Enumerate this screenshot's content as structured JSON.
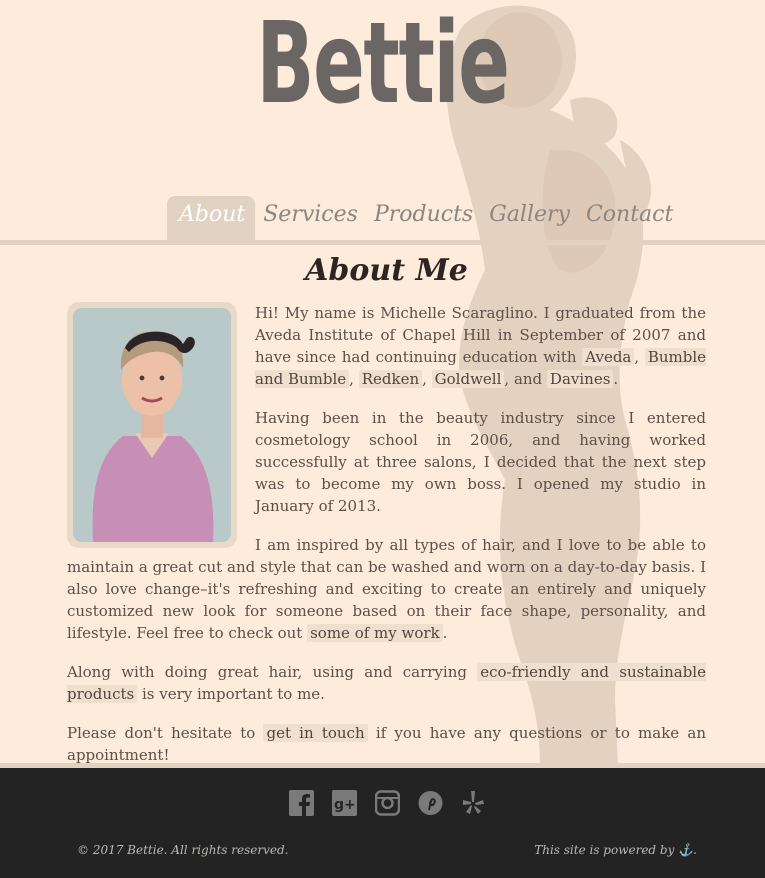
{
  "site": {
    "logo": "Bettie"
  },
  "nav": {
    "items": [
      {
        "label": "About",
        "active": true
      },
      {
        "label": "Services",
        "active": false
      },
      {
        "label": "Products",
        "active": false
      },
      {
        "label": "Gallery",
        "active": false
      },
      {
        "label": "Contact",
        "active": false
      }
    ]
  },
  "main": {
    "title": "About Me",
    "p1": {
      "t1": "Hi! My name is Michelle Scaraglino. I graduated from the Aveda Institute of Chapel Hill in September of 2007 and have since had continuing education with ",
      "l1": "Aveda",
      "t2": ", ",
      "l2": "Bumble and Bumble",
      "t3": ", ",
      "l3": "Redken",
      "t4": ", ",
      "l4": "Goldwell",
      "t5": ", and ",
      "l5": "Davines",
      "t6": "."
    },
    "p2": "Having been in the beauty industry since I entered cosmetology school in 2006, and having worked successfully at three salons, I decided that the next step was to become my own boss. I opened my studio in January of 2013.",
    "p3": {
      "t1": "I am inspired by all types of hair, and I love to be able to maintain a great cut and style that can be washed and worn on a day-to-day basis. I also love change–it's refreshing and exciting to create an entirely and uniquely customized new look for someone based on their face shape, personality, and lifestyle. Feel free to check out ",
      "l1": "some of my work",
      "t2": "."
    },
    "p4": {
      "t1": "Along with doing great hair, using and carrying ",
      "l1": "eco-friendly and sustainable products",
      "t2": " is very important to me."
    },
    "p5": {
      "t1": "Please don't hesitate to ",
      "l1": "get in touch",
      "t2": " if you have any questions or to make an appointment!"
    }
  },
  "footer": {
    "social": [
      "facebook-icon",
      "google-plus-icon",
      "instagram-icon",
      "pinterest-icon",
      "yelp-icon"
    ],
    "copyright": "© 2017 Bettie. All rights reserved.",
    "powered": "This site is powered by",
    "powered_end": "."
  },
  "colors": {
    "background": "#fdebdb",
    "accent": "#e2d2c1",
    "footer": "#232323",
    "logo": "#6b6663"
  }
}
